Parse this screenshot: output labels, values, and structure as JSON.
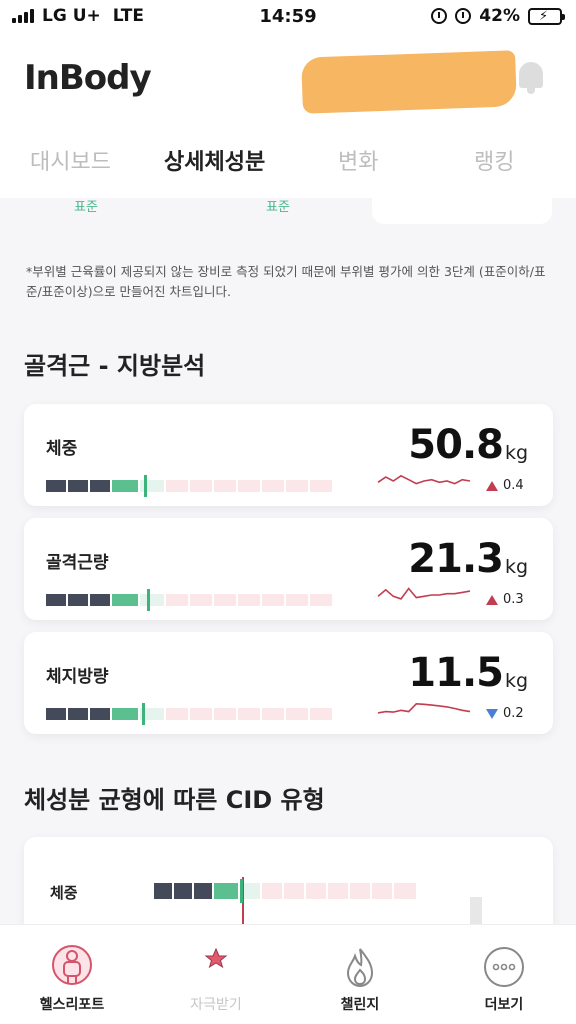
{
  "status_bar": {
    "carrier": "LG U+",
    "network": "LTE",
    "time": "14:59",
    "battery": "42%",
    "battery_level": 0.42
  },
  "header": {
    "logo": "InBody",
    "icons": [
      "bell-icon"
    ]
  },
  "tabs": [
    {
      "label": "대시보드",
      "active": false
    },
    {
      "label": "상세체성분",
      "active": true
    },
    {
      "label": "변화",
      "active": false
    },
    {
      "label": "랭킹",
      "active": false
    }
  ],
  "previous_section": {
    "labels": [
      "표준",
      "표준"
    ]
  },
  "note": "*부위별 근육률이 제공되지 않는 장비로 측정 되었기 때문에 부위별 평가에 의한 3단계 (표준이하/표준/표준이상)으로 만들어진 차트입니다.",
  "analysis": {
    "title": "골격근 - 지방분석",
    "items": [
      {
        "label": "체중",
        "value": "50.8",
        "unit": "kg",
        "delta": "0.4",
        "direction": "up",
        "marker_fraction": 0.325,
        "trend": [
          0.55,
          0.35,
          0.5,
          0.3,
          0.45,
          0.6,
          0.5,
          0.45,
          0.55,
          0.5,
          0.6,
          0.45,
          0.5
        ]
      },
      {
        "label": "골격근량",
        "value": "21.3",
        "unit": "kg",
        "delta": "0.3",
        "direction": "up",
        "marker_fraction": 0.335,
        "trend": [
          0.55,
          0.3,
          0.55,
          0.65,
          0.25,
          0.6,
          0.55,
          0.5,
          0.5,
          0.45,
          0.45,
          0.4,
          0.35
        ]
      },
      {
        "label": "체지방량",
        "value": "11.5",
        "unit": "kg",
        "delta": "0.2",
        "direction": "down",
        "marker_fraction": 0.32,
        "trend": [
          0.65,
          0.6,
          0.62,
          0.55,
          0.6,
          0.3,
          0.32,
          0.35,
          0.38,
          0.42,
          0.48,
          0.55,
          0.6
        ]
      }
    ]
  },
  "cid": {
    "title": "체성분 균형에 따른 CID 유형",
    "rows": [
      {
        "label": "체중"
      }
    ]
  },
  "colors": {
    "dark": "#454a5a",
    "green": "#5bbf8f",
    "pink": "#fbe6ea",
    "trend": "#c33d51",
    "up": "#c33d51",
    "down": "#4a7fd4"
  },
  "bottom_nav": [
    {
      "label": "헬스리포트",
      "icon": "body-icon",
      "active": true
    },
    {
      "label": "자극받기",
      "icon": "star-icon",
      "active": false
    },
    {
      "label": "챌린지",
      "icon": "flame-icon",
      "active": false
    },
    {
      "label": "더보기",
      "icon": "more-icon",
      "active": false
    }
  ]
}
